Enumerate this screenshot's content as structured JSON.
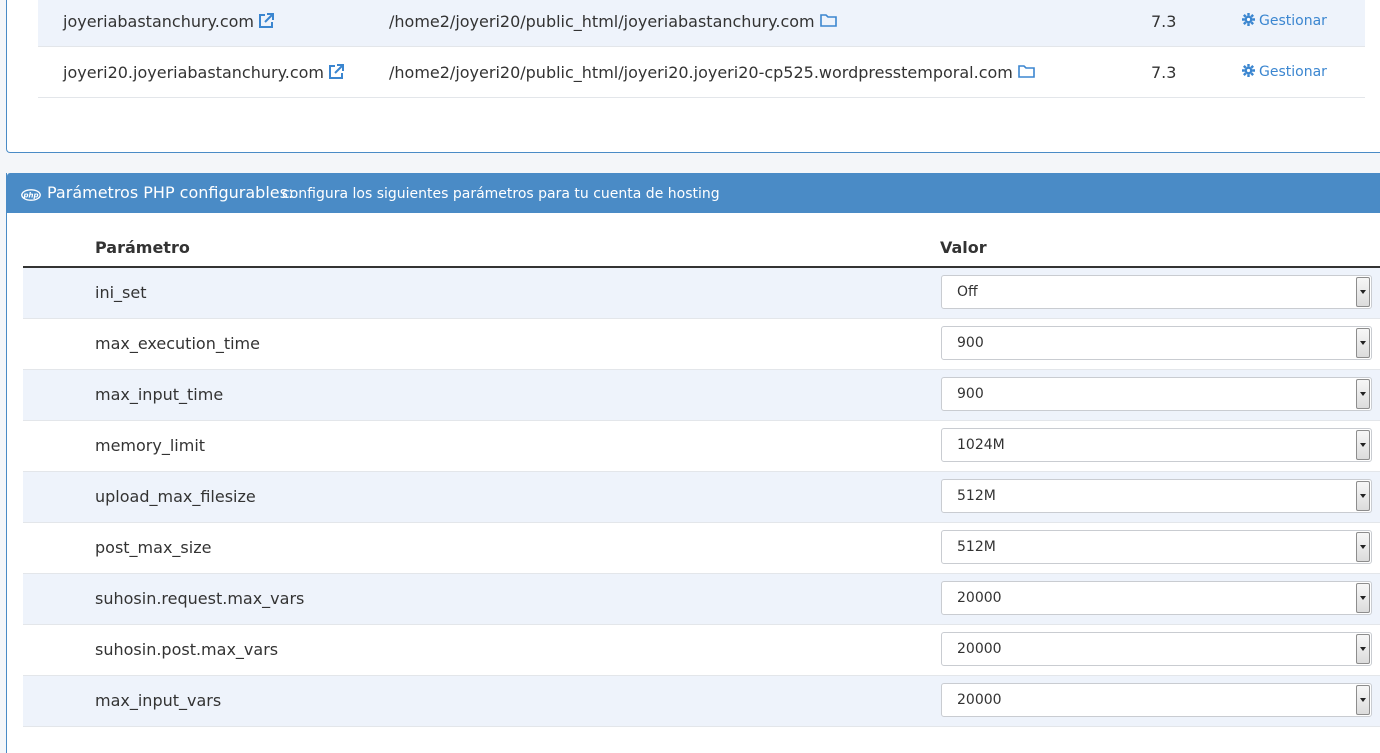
{
  "domains": {
    "rows": [
      {
        "domain": "joyeriabastanchury.com",
        "path": "/home2/joyeri20/public_html/joyeriabastanchury.com",
        "php_version": "7.3",
        "manage_label": "Gestionar"
      },
      {
        "domain": "joyeri20.joyeriabastanchury.com",
        "path": "/home2/joyeri20/public_html/joyeri20.joyeri20-cp525.wordpresstemporal.com",
        "php_version": "7.3",
        "manage_label": "Gestionar"
      }
    ]
  },
  "php_params": {
    "header": {
      "title": "Parámetros PHP configurables:",
      "subtitle": "configura los siguientes parámetros para tu cuenta de hosting",
      "logo_text": "php"
    },
    "columns": {
      "param": "Parámetro",
      "value": "Valor"
    },
    "rows": [
      {
        "name": "ini_set",
        "value": "Off"
      },
      {
        "name": "max_execution_time",
        "value": "900"
      },
      {
        "name": "max_input_time",
        "value": "900"
      },
      {
        "name": "memory_limit",
        "value": "1024M"
      },
      {
        "name": "upload_max_filesize",
        "value": "512M"
      },
      {
        "name": "post_max_size",
        "value": "512M"
      },
      {
        "name": "suhosin.request.max_vars",
        "value": "20000"
      },
      {
        "name": "suhosin.post.max_vars",
        "value": "20000"
      },
      {
        "name": "max_input_vars",
        "value": "20000"
      }
    ]
  },
  "colors": {
    "accent": "#4a8bc6",
    "link": "#3b86d0",
    "row_stripe": "#eef3fb"
  },
  "icons": {
    "external": "external-link-icon",
    "folder": "folder-icon",
    "gear": "gear-icon",
    "php_logo": "php-logo-icon",
    "select_arrow": "chevron-down-icon"
  }
}
